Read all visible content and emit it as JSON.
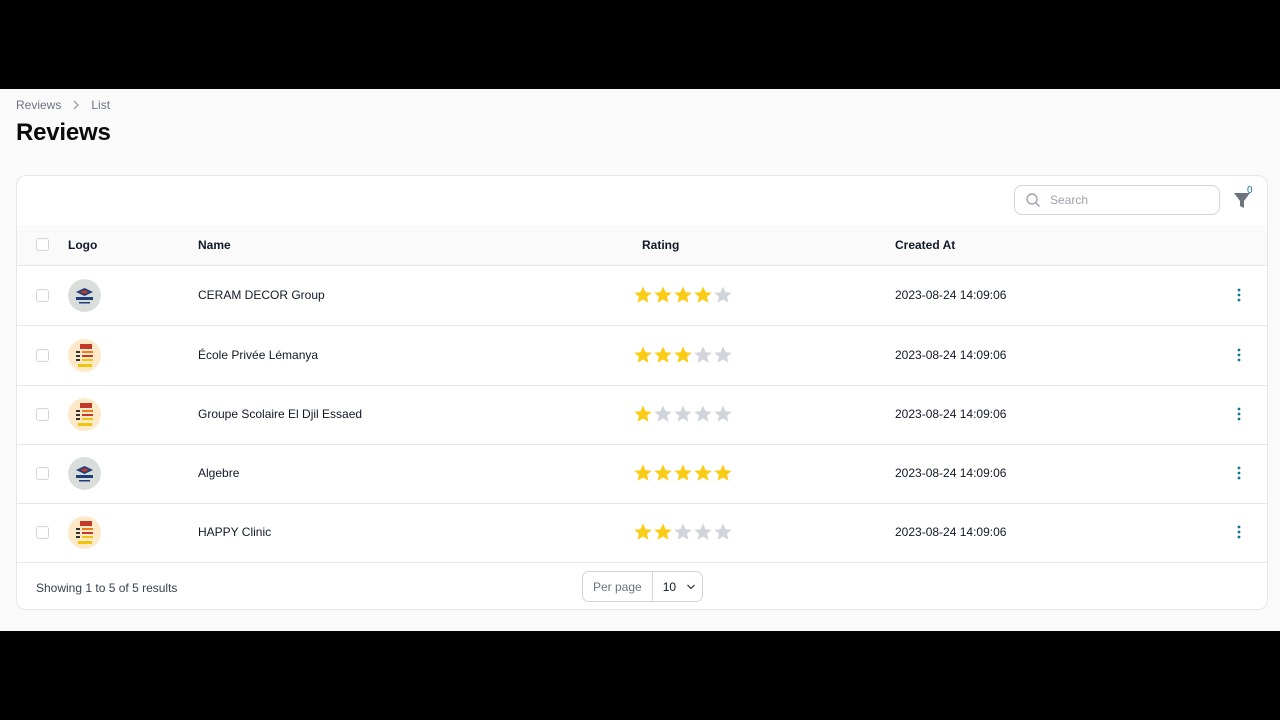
{
  "breadcrumb": {
    "parent": "Reviews",
    "current": "List"
  },
  "page": {
    "title": "Reviews"
  },
  "search": {
    "placeholder": "Search"
  },
  "filter": {
    "count": "0"
  },
  "table": {
    "headers": {
      "logo": "Logo",
      "name": "Name",
      "rating": "Rating",
      "created_at": "Created At"
    },
    "rows": [
      {
        "logo": "ceram-logo",
        "name": "CERAM DECOR Group",
        "rating": 4,
        "created_at": "2023-08-24 14:09:06"
      },
      {
        "logo": "school-logo",
        "name": "École Privée Lémanya",
        "rating": 3,
        "created_at": "2023-08-24 14:09:06"
      },
      {
        "logo": "school-logo",
        "name": "Groupe Scolaire El Djil Essaed",
        "rating": 1,
        "created_at": "2023-08-24 14:09:06"
      },
      {
        "logo": "ceram-logo",
        "name": "Algebre",
        "rating": 5,
        "created_at": "2023-08-24 14:09:06"
      },
      {
        "logo": "school-logo",
        "name": "HAPPY Clinic",
        "rating": 2,
        "created_at": "2023-08-24 14:09:06"
      }
    ]
  },
  "footer": {
    "summary": "Showing 1 to 5 of 5 results",
    "per_page_label": "Per page",
    "per_page_value": "10"
  },
  "colors": {
    "star_filled": "#facc15",
    "star_empty": "#d1d5db",
    "accent": "#0e7490"
  }
}
